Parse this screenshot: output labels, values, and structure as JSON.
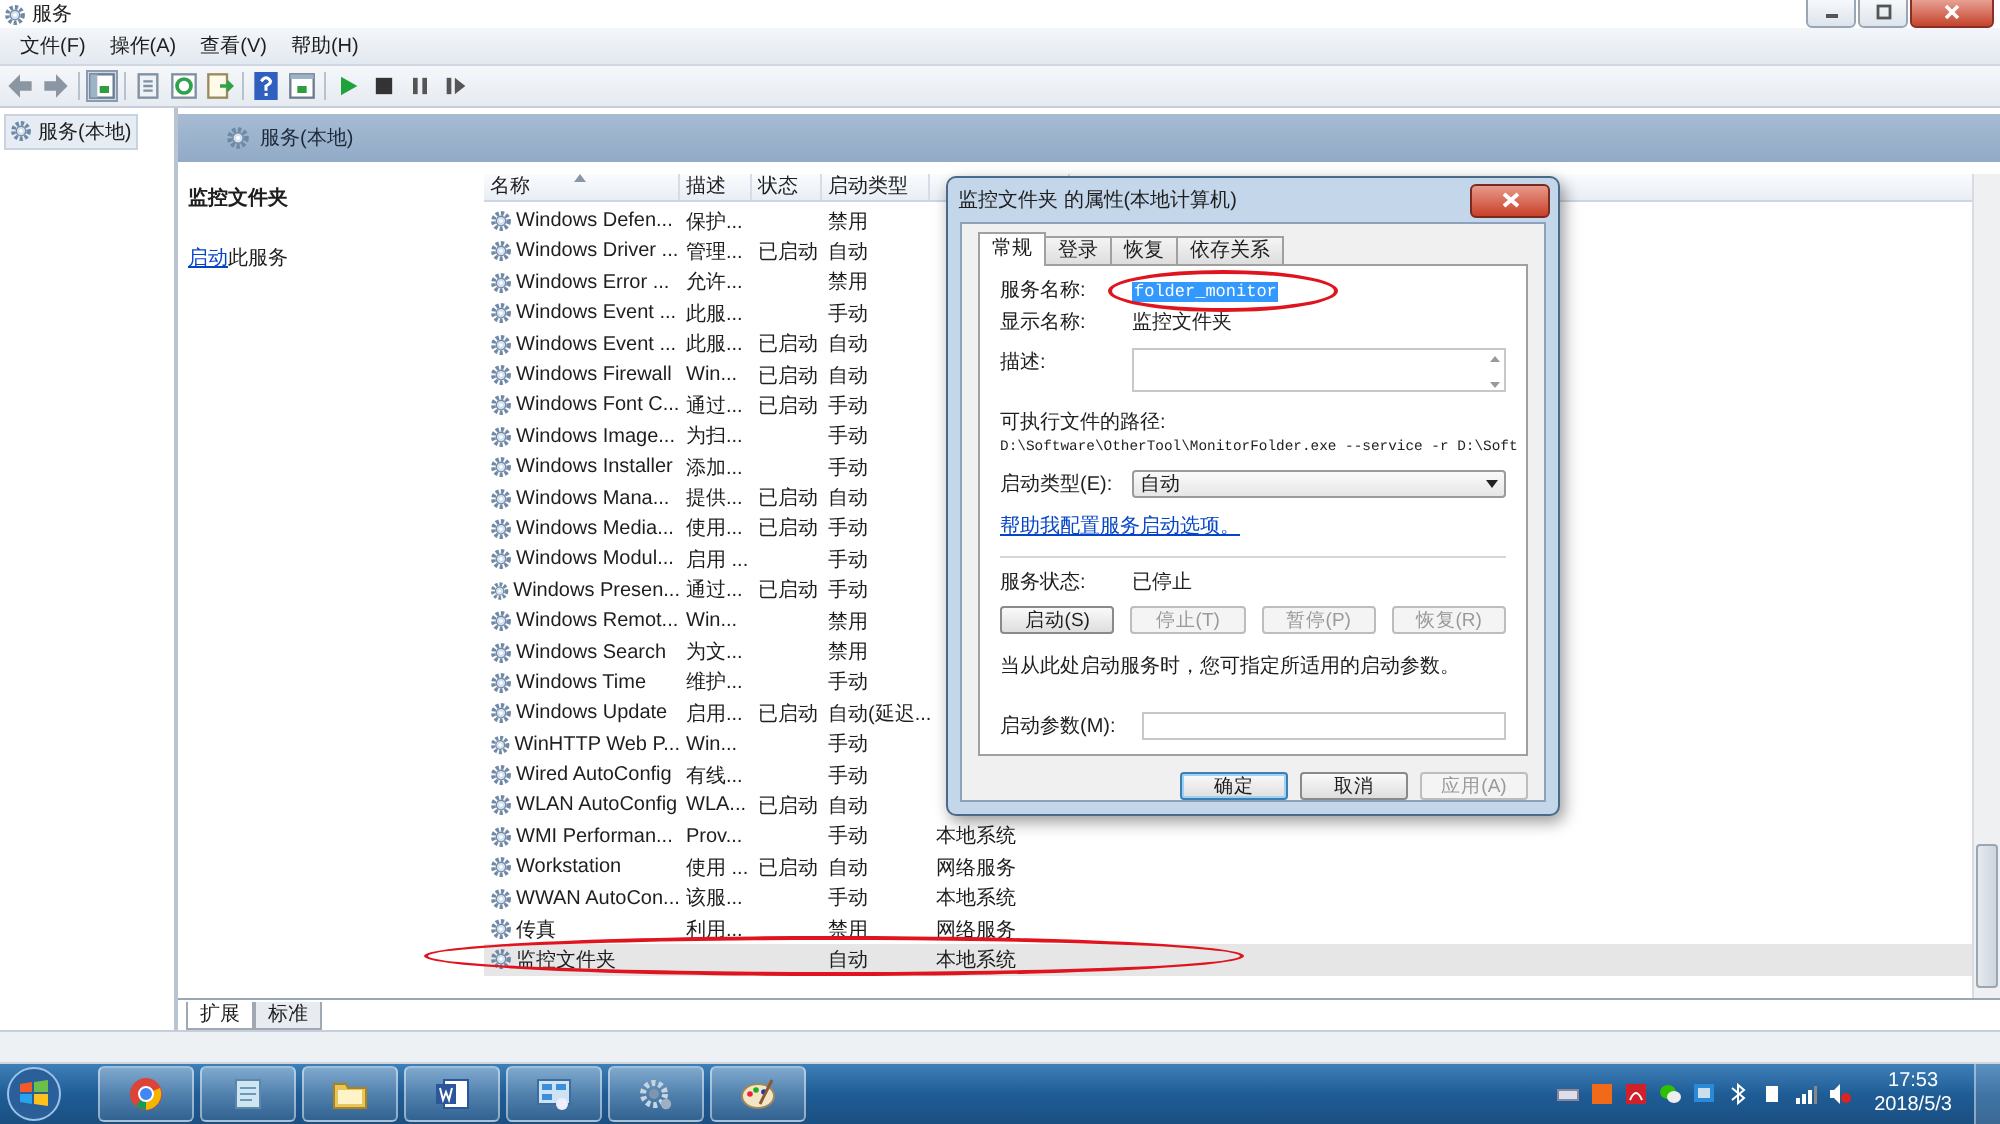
{
  "window": {
    "title": "服务"
  },
  "menu": [
    "文件(F)",
    "操作(A)",
    "查看(V)",
    "帮助(H)"
  ],
  "tree": [
    {
      "label": "服务(本地)",
      "selected": true
    }
  ],
  "pane_header": "服务(本地)",
  "description": {
    "title": "监控文件夹",
    "link": "启动",
    "text": "此服务"
  },
  "table": {
    "columns": [
      "名称",
      "描述",
      "状态",
      "启动类型"
    ],
    "rows": [
      {
        "name": "Windows Defen...",
        "description": "保护...",
        "startup": "禁用",
        "selected": false
      },
      {
        "name": "Windows Driver ...",
        "description": "管理...",
        "status": "已启动",
        "startup": "自动",
        "selected": false
      },
      {
        "name": "Windows Error ...",
        "description": "允许...",
        "startup": "禁用",
        "selected": false
      },
      {
        "name": "Windows Event ...",
        "description": "此服...",
        "startup": "手动",
        "selected": false
      },
      {
        "name": "Windows Event ...",
        "description": "此服...",
        "status": "已启动",
        "startup": "自动",
        "selected": false
      },
      {
        "name": "Windows Firewall",
        "description": "Win...",
        "status": "已启动",
        "startup": "自动",
        "selected": false
      },
      {
        "name": "Windows Font C...",
        "description": "通过...",
        "status": "已启动",
        "startup": "手动",
        "selected": false
      },
      {
        "name": "Windows Image...",
        "description": "为扫...",
        "startup": "手动",
        "selected": false
      },
      {
        "name": "Windows Installer",
        "description": "添加...",
        "startup": "手动",
        "selected": false
      },
      {
        "name": "Windows Mana...",
        "description": "提供...",
        "status": "已启动",
        "startup": "自动",
        "selected": false
      },
      {
        "name": "Windows Media...",
        "description": "使用...",
        "status": "已启动",
        "startup": "手动",
        "selected": false
      },
      {
        "name": "Windows Modul...",
        "description": "启用 ...",
        "startup": "手动",
        "selected": false
      },
      {
        "name": "Windows Presen...",
        "description": "通过...",
        "status": "已启动",
        "startup": "手动",
        "selected": false
      },
      {
        "name": "Windows Remot...",
        "description": "Win...",
        "startup": "禁用",
        "selected": false
      },
      {
        "name": "Windows Search",
        "description": "为文...",
        "startup": "禁用",
        "selected": false
      },
      {
        "name": "Windows Time",
        "description": "维护...",
        "startup": "手动",
        "selected": false
      },
      {
        "name": "Windows Update",
        "description": "启用...",
        "status": "已启动",
        "startup": "自动(延迟...",
        "selected": false
      },
      {
        "name": "WinHTTP Web P...",
        "description": "Win...",
        "startup": "手动",
        "selected": false
      },
      {
        "name": "Wired AutoConfig",
        "description": "有线...",
        "startup": "手动",
        "selected": false
      },
      {
        "name": "WLAN AutoConfig",
        "description": "WLA...",
        "status": "已启动",
        "startup": "自动",
        "selected": false
      },
      {
        "name": "WMI Performan...",
        "description": "Prov...",
        "startup": "手动",
        "logon": "本地系统",
        "selected": false
      },
      {
        "name": "Workstation",
        "description": "使用 ...",
        "status": "已启动",
        "startup": "自动",
        "logon": "网络服务",
        "selected": false
      },
      {
        "name": "WWAN AutoCon...",
        "description": "该服...",
        "startup": "手动",
        "logon": "本地系统",
        "selected": false
      },
      {
        "name": "传真",
        "description": "利用...",
        "startup": "禁用",
        "logon": "网络服务",
        "selected": false
      },
      {
        "name": "监控文件夹",
        "startup": "自动",
        "logon": "本地系统",
        "selected": true,
        "circled": true
      }
    ]
  },
  "bottom_tabs": [
    {
      "label": "扩展",
      "selected": true
    },
    {
      "label": "标准",
      "selected": false
    }
  ],
  "dialog": {
    "title": "监控文件夹 的属性(本地计算机)",
    "tabs": [
      {
        "label": "常规",
        "selected": true
      },
      {
        "label": "登录",
        "selected": false
      },
      {
        "label": "恢复",
        "selected": false
      },
      {
        "label": "依存关系",
        "selected": false
      }
    ],
    "service_name_label": "服务名称:",
    "service_name": "folder_monitor",
    "service_name_circled": true,
    "display_name_label": "显示名称:",
    "display_name": "监控文件夹",
    "description_label": "描述:",
    "path_label": "可执行文件的路径:",
    "path": "D:\\Software\\OtherTool\\MonitorFolder.exe --service -r D:\\Soft",
    "startup_type_label": "启动类型(E):",
    "startup_type": "自动",
    "help_link": "帮助我配置服务启动选项。",
    "status_label": "服务状态:",
    "status": "已停止",
    "control_buttons": [
      {
        "label": "启动(S)",
        "disabled": false
      },
      {
        "label": "停止(T)",
        "disabled": true
      },
      {
        "label": "暂停(P)",
        "disabled": true
      },
      {
        "label": "恢复(R)",
        "disabled": true
      }
    ],
    "hint": "当从此处启动服务时，您可指定所适用的启动参数。",
    "params_label": "启动参数(M):",
    "footer_buttons": [
      {
        "label": "确定",
        "default": true,
        "disabled": false
      },
      {
        "label": "取消",
        "default": false,
        "disabled": false
      },
      {
        "label": "应用(A)",
        "default": false,
        "disabled": true
      }
    ]
  },
  "taskbar": {
    "apps": [
      {
        "kind": "browser"
      },
      {
        "kind": "notepad"
      },
      {
        "kind": "folder"
      },
      {
        "kind": "word"
      },
      {
        "kind": "panel"
      },
      {
        "kind": "gear"
      },
      {
        "kind": "paint"
      }
    ],
    "clock": {
      "time": "17:53",
      "date": "2018/5/3"
    }
  }
}
